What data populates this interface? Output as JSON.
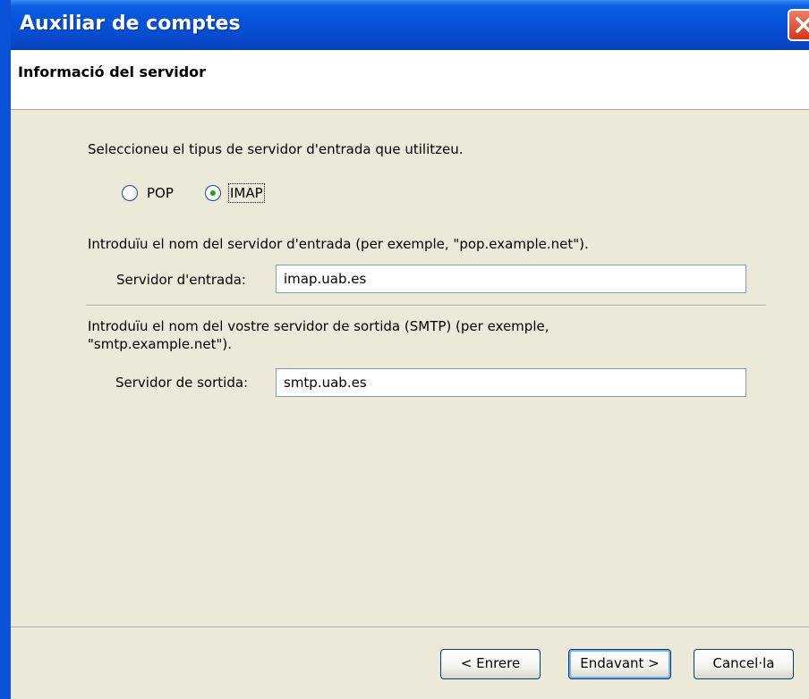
{
  "window": {
    "title": "Auxiliar de comptes"
  },
  "header": {
    "title": "Informació del servidor"
  },
  "incoming_type": {
    "prompt": "Seleccioneu el tipus de servidor d'entrada que utilitzeu.",
    "options": [
      {
        "label": "POP",
        "selected": false
      },
      {
        "label": "IMAP",
        "selected": true
      }
    ]
  },
  "incoming_server": {
    "prompt": "Introduïu el nom del servidor d'entrada (per exemple, \"pop.example.net\").",
    "label": "Servidor d'entrada:",
    "value": "imap.uab.es"
  },
  "outgoing_server": {
    "prompt_line1": "Introduïu el nom del vostre servidor de sortida (SMTP) (per exemple,",
    "prompt_line2": "\"smtp.example.net\").",
    "label": "Servidor de sortida:",
    "value": "smtp.uab.es"
  },
  "buttons": {
    "back": "< Enrere",
    "next": "Endavant >",
    "cancel": "Cancel·la"
  }
}
